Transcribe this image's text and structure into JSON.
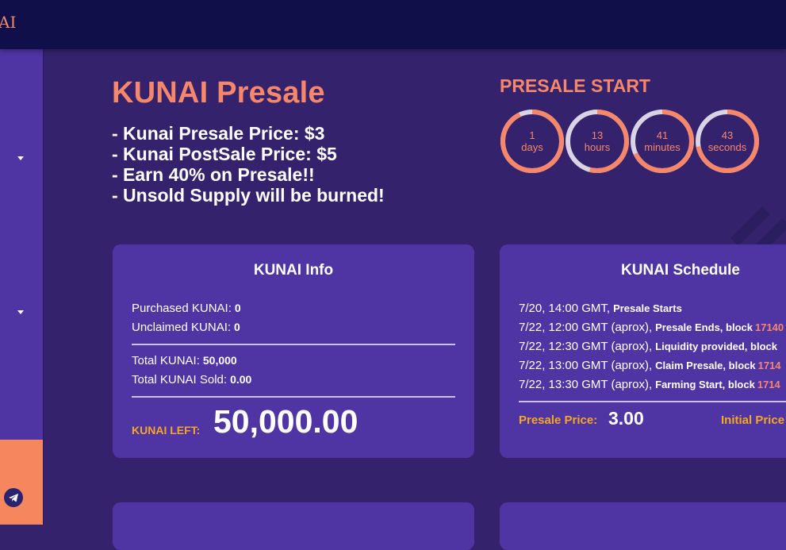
{
  "header": {
    "logo_text": "AI"
  },
  "hero": {
    "title": "KUNAI Presale",
    "bullets": [
      "- Kunai Presale Price: $3",
      "- Kunai PostSale Price: $5",
      "- Earn 40% on Presale!!",
      "- Unsold Supply will be burned!"
    ]
  },
  "countdown": {
    "title": "PRESALE START",
    "accent": "#f7876a",
    "track": "#d9d4e4",
    "items": [
      {
        "value": "1",
        "unit": "days",
        "progress": 0.93
      },
      {
        "value": "13",
        "unit": "hours",
        "progress": 0.54
      },
      {
        "value": "41",
        "unit": "minutes",
        "progress": 0.68
      },
      {
        "value": "43",
        "unit": "seconds",
        "progress": 0.72
      }
    ]
  },
  "info_card": {
    "title": "KUNAI Info",
    "purchased_label": "Purchased KUNAI:",
    "purchased_value": "0",
    "unclaimed_label": "Unclaimed KUNAI:",
    "unclaimed_value": "0",
    "total_label": "Total KUNAI:",
    "total_value": "50,000",
    "sold_label": "Total KUNAI Sold:",
    "sold_value": "0.00",
    "left_label": "KUNAI LEFT:",
    "left_value": "50,000.00"
  },
  "schedule_card": {
    "title": "KUNAI Schedule",
    "rows": [
      {
        "time": "7/20, 14:00 GMT,",
        "event": "Presale Starts",
        "block": ""
      },
      {
        "time": "7/22, 12:00 GMT (aprox),",
        "event": "Presale Ends, block",
        "block": "17140"
      },
      {
        "time": "7/22, 12:30 GMT (aprox),",
        "event": "Liquidity provided, block",
        "block": ""
      },
      {
        "time": "7/22, 13:00 GMT (aprox),",
        "event": "Claim Presale, block",
        "block": "1714"
      },
      {
        "time": "7/22, 13:30 GMT (aprox),",
        "event": "Farming Start, block",
        "block": "1714"
      }
    ],
    "presale_price_label": "Presale Price:",
    "presale_price_value": "3.00",
    "initial_price_label": "Initial Price"
  },
  "colors": {
    "background": "#35226d",
    "topbar": "#110f4a",
    "card": "#4f35a4",
    "accent_orange": "#f7876a",
    "label_gold": "#f5a623"
  }
}
